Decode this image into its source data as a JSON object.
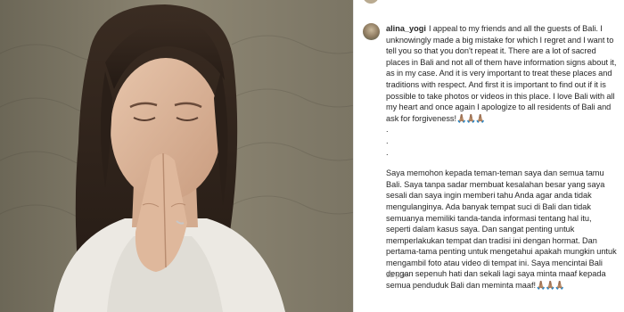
{
  "post": {
    "username": "alina_yogi",
    "caption_en": "I appeal to my friends and all the guests of Bali. I unknowingly made a big mistake for which I regret and I want to tell you so that you don't repeat it. There are a lot of sacred places in Bali and not all of them have information signs about it, as in my case. And it is very important to treat these places and traditions with respect. And first it is important to find out if it is possible to take photos or videos in this place. I love Bali with all my heart and once again I apologize to all residents of Bali and ask for forgiveness!",
    "emoji_en": "🙏🏽🙏🏽🙏🏽",
    "separator_dots": [
      ".",
      ".",
      "."
    ],
    "caption_id": "Saya memohon kepada teman-teman saya dan semua tamu Bali. Saya tanpa sadar membuat kesalahan besar yang saya sesali dan saya ingin memberi tahu Anda agar anda tidak mengulanginya. Ada banyak tempat suci di Bali dan tidak semuanya memiliki tanda-tanda informasi tentang hal itu, seperti dalam kasus saya. Dan sangat penting untuk memperlakukan tempat dan tradisi ini dengan hormat. Dan pertama-tama penting untuk mengetahui apakah mungkin untuk mengambil foto atau video di tempat ini. Saya mencintai Bali dengan sepenuh hati dan sekali lagi saya minta maaf kepada semua penduduk Bali dan meminta maaf!",
    "emoji_id": "🙏🏽🙏🏽🙏🏽",
    "timestamp": "12 jam"
  },
  "colors": {
    "text": "#262626",
    "muted": "#8e8e8e",
    "divider": "#e6e6e6"
  }
}
